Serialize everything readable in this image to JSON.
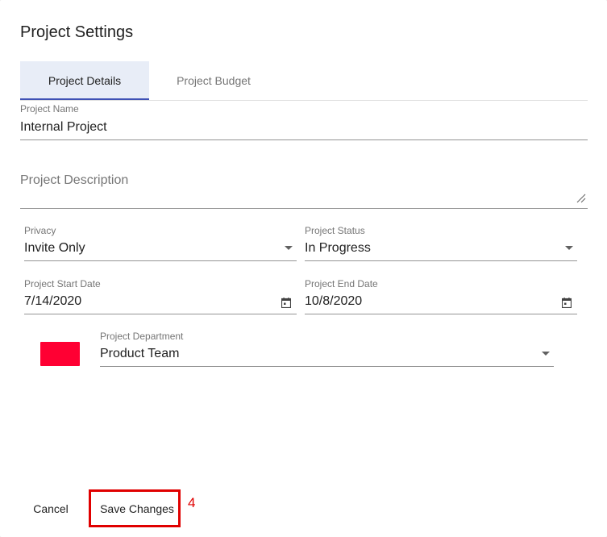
{
  "dialog": {
    "title": "Project Settings"
  },
  "tabs": [
    {
      "label": "Project Details",
      "active": true
    },
    {
      "label": "Project Budget",
      "active": false
    }
  ],
  "form": {
    "project_name": {
      "label": "Project Name",
      "value": "Internal Project"
    },
    "project_description": {
      "placeholder": "Project Description"
    },
    "privacy": {
      "label": "Privacy",
      "value": "Invite Only"
    },
    "project_status": {
      "label": "Project Status",
      "value": "In Progress"
    },
    "start_date": {
      "label": "Project Start Date",
      "value": "7/14/2020"
    },
    "end_date": {
      "label": "Project End Date",
      "value": "10/8/2020"
    },
    "department": {
      "label": "Project Department",
      "value": "Product Team",
      "color": "#ff0033"
    }
  },
  "actions": {
    "cancel_label": "Cancel",
    "save_label": "Save Changes"
  },
  "annotation": {
    "step_number": "4",
    "color": "#e00000"
  },
  "colors": {
    "accent": "#3f51b5",
    "active_tab_bg": "#e8edf7"
  }
}
